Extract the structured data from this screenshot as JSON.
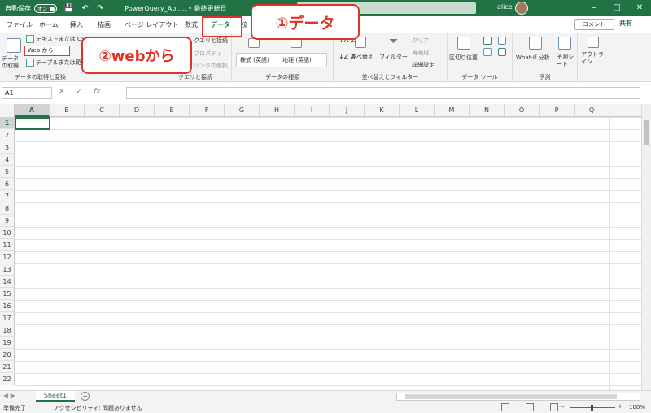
{
  "titlebar": {
    "autosave_label": "自動保存",
    "autosave_state": "オン",
    "doc_title": "PowerQuery_Api.... • 最終更新日",
    "search_hint": "(Q)",
    "user": "alice",
    "controls": [
      "–",
      "□",
      "✕"
    ]
  },
  "tabs": [
    {
      "label": "ファイル"
    },
    {
      "label": "ホーム"
    },
    {
      "label": "挿入"
    },
    {
      "label": "描画"
    },
    {
      "label": "ページ レイアウト"
    },
    {
      "label": "数式"
    },
    {
      "label": "データ"
    },
    {
      "label": "校"
    }
  ],
  "actions": {
    "comment": "コメント",
    "share": "共有"
  },
  "ribbon": {
    "get_data": {
      "big_label": "データの取得",
      "text_csv": "テキストまたは CSV",
      "web": "Web から",
      "table_range": "テーブルまたは範囲",
      "group_label": "データの取得と変換"
    },
    "queries": {
      "items": [
        "クエリと接続",
        "プロパティ",
        "リンクの編集"
      ],
      "group_label": "クエリと接続"
    },
    "data_types": {
      "stock": "株式 (英語)",
      "geo": "地理 (英語)",
      "group_label": "データの種類"
    },
    "sort_filter": {
      "sort": "並べ替え",
      "filter": "フィルター",
      "clear": "クリア",
      "reapply": "再適用",
      "advanced": "詳細設定",
      "group_label": "並べ替えとフィルター"
    },
    "data_tools": {
      "text_to_columns": "区切り位置",
      "group_label": "データ ツール"
    },
    "forecast": {
      "whatif": "What-If 分析",
      "sheet": "予測シート",
      "group_label": "予測"
    },
    "outline": {
      "label": "アウトライン"
    }
  },
  "callouts": {
    "step1": "①データ",
    "step2": "②webから"
  },
  "formula_bar": {
    "name_box": "A1",
    "fx": "fx",
    "cancel": "✕",
    "enter": "✓"
  },
  "grid": {
    "columns": [
      "A",
      "B",
      "C",
      "D",
      "E",
      "F",
      "G",
      "H",
      "I",
      "J",
      "K",
      "L",
      "M",
      "N",
      "O",
      "P",
      "Q"
    ],
    "rows": [
      "1",
      "2",
      "3",
      "4",
      "5",
      "6",
      "7",
      "8",
      "9",
      "10",
      "11",
      "12",
      "13",
      "14",
      "15",
      "16",
      "17",
      "18",
      "19",
      "20",
      "21",
      "22"
    ],
    "selected_cell": "A1"
  },
  "sheets": {
    "tabs": [
      "Sheet1"
    ],
    "add": "+"
  },
  "status": {
    "ready": "準備完了",
    "accessibility": "アクセシビリティ: 問題ありません",
    "zoom": "100%",
    "zoom_minus": "–",
    "zoom_plus": "+"
  }
}
